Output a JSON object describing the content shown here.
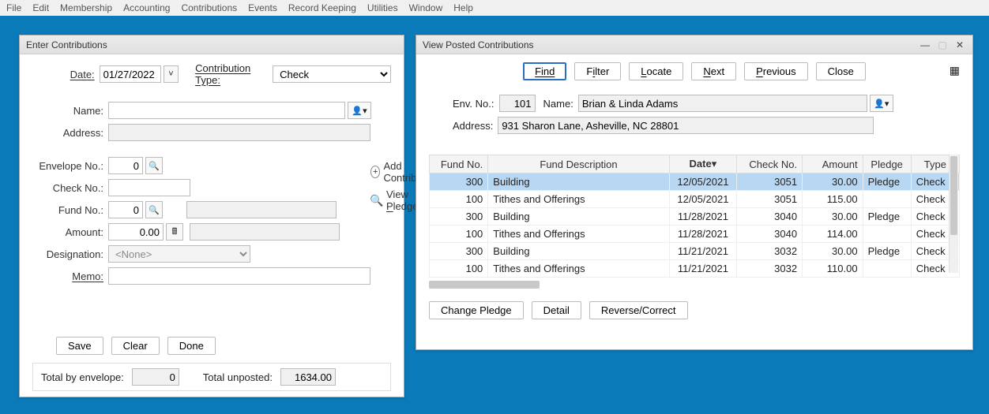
{
  "menu": [
    "File",
    "Edit",
    "Membership",
    "Accounting",
    "Contributions",
    "Events",
    "Record Keeping",
    "Utilities",
    "Window",
    "Help"
  ],
  "enter": {
    "title": "Enter Contributions",
    "date_label": "Date:",
    "date": "01/27/2022",
    "contrib_type_label": "Contribution Type:",
    "contrib_type": "Check",
    "name_label": "Name:",
    "name": "",
    "address_label": "Address:",
    "address": "",
    "env_label": "Envelope No.:",
    "env": "0",
    "check_label": "Check No.:",
    "check": "",
    "fund_label": "Fund No.:",
    "fund": "0",
    "amount_label": "Amount:",
    "amount": "0.00",
    "designation_label": "Designation:",
    "designation": "<None>",
    "memo_label": "Memo:",
    "memo": "",
    "add_contrib": "Add Contributor",
    "view_pledges": "View Pledges",
    "save": "Save",
    "clear": "Clear",
    "done": "Done",
    "total_env_label": "Total by envelope:",
    "total_env": "0",
    "total_unposted_label": "Total unposted:",
    "total_unposted": "1634.00"
  },
  "view": {
    "title": "View Posted Contributions",
    "find": "Find",
    "filter": "Filter",
    "locate": "Locate",
    "next": "Next",
    "previous": "Previous",
    "close": "Close",
    "env_label": "Env. No.:",
    "env": "101",
    "name_label": "Name:",
    "name": "Brian & Linda Adams",
    "address_label": "Address:",
    "address": "931 Sharon Lane, Asheville, NC 28801",
    "cols": [
      "Fund No.",
      "Fund Description",
      "Date",
      "Check No.",
      "Amount",
      "Pledge",
      "Type"
    ],
    "sort_indicator": "▾",
    "rows": [
      {
        "fund": "300",
        "desc": "Building",
        "date": "12/05/2021",
        "check": "3051",
        "amount": "30.00",
        "pledge": "Pledge",
        "type": "Check",
        "sel": true
      },
      {
        "fund": "100",
        "desc": "Tithes and Offerings",
        "date": "12/05/2021",
        "check": "3051",
        "amount": "115.00",
        "pledge": "",
        "type": "Check"
      },
      {
        "fund": "300",
        "desc": "Building",
        "date": "11/28/2021",
        "check": "3040",
        "amount": "30.00",
        "pledge": "Pledge",
        "type": "Check"
      },
      {
        "fund": "100",
        "desc": "Tithes and Offerings",
        "date": "11/28/2021",
        "check": "3040",
        "amount": "114.00",
        "pledge": "",
        "type": "Check"
      },
      {
        "fund": "300",
        "desc": "Building",
        "date": "11/21/2021",
        "check": "3032",
        "amount": "30.00",
        "pledge": "Pledge",
        "type": "Check"
      },
      {
        "fund": "100",
        "desc": "Tithes and Offerings",
        "date": "11/21/2021",
        "check": "3032",
        "amount": "110.00",
        "pledge": "",
        "type": "Check"
      }
    ],
    "change_pledge": "Change Pledge",
    "detail": "Detail",
    "reverse": "Reverse/Correct"
  }
}
